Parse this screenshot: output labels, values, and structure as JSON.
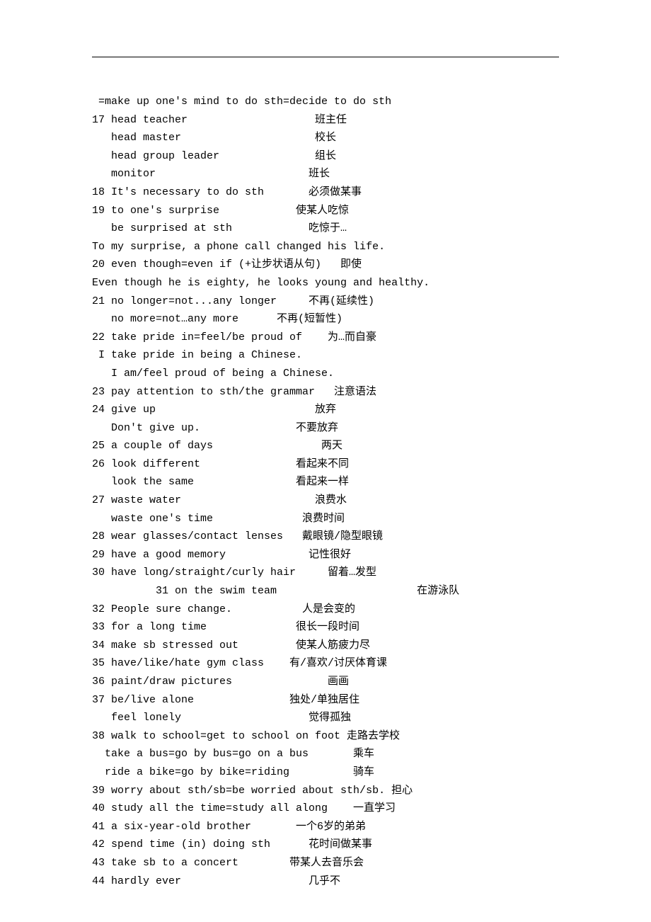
{
  "lines": [
    " =make up one's mind to do sth=decide to do sth",
    "17 head teacher                    班主任",
    "   head master                     校长",
    "   head group leader               组长",
    "   monitor                        班长",
    "18 It's necessary to do sth       必须做某事",
    "19 to one's surprise            使某人吃惊",
    "   be surprised at sth            吃惊于…",
    "To my surprise, a phone call changed his life.",
    "20 even though=even if (+让步状语从句)   即使",
    "Even though he is eighty, he looks young and healthy.",
    "21 no longer=not...any longer     不再(延续性)",
    "   no more=not…any more      不再(短暂性)",
    "22 take pride in=feel/be proud of    为…而自豪",
    " I take pride in being a Chinese.",
    "   I am/feel proud of being a Chinese.",
    "23 pay attention to sth/the grammar   注意语法",
    "24 give up                         放弃",
    "   Don't give up.               不要放弃",
    "25 a couple of days                 两天",
    "26 look different               看起来不同",
    "   look the same                看起来一样",
    "27 waste water                     浪费水",
    "   waste one's time              浪费时间",
    "28 wear glasses/contact lenses   戴眼镜/隐型眼镜",
    "29 have a good memory             记性很好",
    "30 have long/straight/curly hair     留着…发型",
    "          31 on the swim team                      在游泳队",
    "32 People sure change.           人是会变的",
    "33 for a long time              很长一段时间",
    "34 make sb stressed out         使某人筋疲力尽",
    "35 have/like/hate gym class    有/喜欢/讨厌体育课",
    "36 paint/draw pictures               画画",
    "37 be/live alone               独处/单独居住",
    "   feel lonely                    觉得孤独",
    "38 walk to school=get to school on foot 走路去学校",
    "  take a bus=go by bus=go on a bus       乘车",
    "  ride a bike=go by bike=riding          骑车",
    "39 worry about sth/sb=be worried about sth/sb. 担心",
    "40 study all the time=study all along    一直学习",
    "41 a six-year-old brother       一个6岁的弟弟",
    "42 spend time (in) doing sth      花时间做某事",
    "43 take sb to a concert        带某人去音乐会",
    "44 hardly ever                    几乎不"
  ]
}
